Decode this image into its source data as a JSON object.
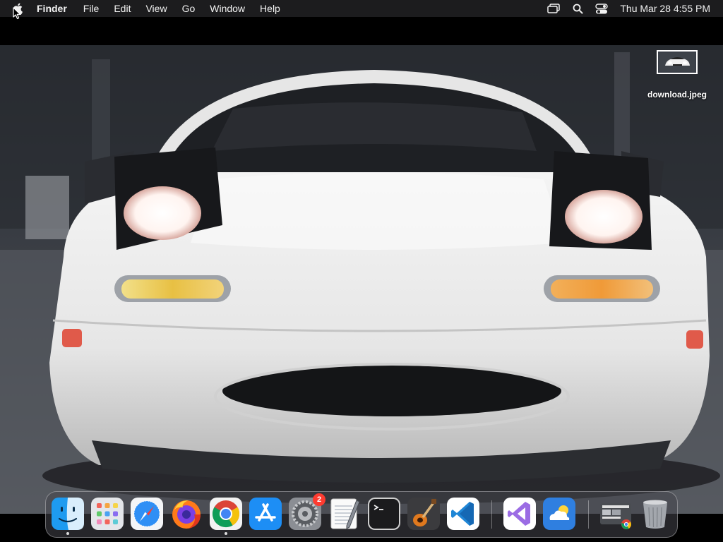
{
  "menubar": {
    "app_name": "Finder",
    "items": [
      "File",
      "Edit",
      "View",
      "Go",
      "Window",
      "Help"
    ],
    "status_icons": [
      "screen-mirroring-icon",
      "search-icon",
      "control-center-icon"
    ],
    "clock": "Thu Mar 28  4:55 PM"
  },
  "desktop": {
    "wallpaper": "white-roadster-front-photo",
    "icons": [
      {
        "label": "download.jpeg",
        "icon": "image-file-icon"
      }
    ]
  },
  "dock": {
    "apps": [
      {
        "name": "Finder",
        "icon": "finder-icon",
        "running": true
      },
      {
        "name": "Launchpad",
        "icon": "launchpad-icon",
        "running": false
      },
      {
        "name": "Safari",
        "icon": "safari-icon",
        "running": false
      },
      {
        "name": "Firefox",
        "icon": "firefox-icon",
        "running": false
      },
      {
        "name": "Google Chrome",
        "icon": "chrome-icon",
        "running": true
      },
      {
        "name": "App Store",
        "icon": "app-store-icon",
        "running": false
      },
      {
        "name": "System Settings",
        "icon": "system-settings-icon",
        "running": false,
        "badge": "2"
      },
      {
        "name": "TextEdit",
        "icon": "textedit-icon",
        "running": false
      },
      {
        "name": "Terminal",
        "icon": "terminal-icon",
        "running": false
      },
      {
        "name": "GarageBand",
        "icon": "garageband-icon",
        "running": false
      },
      {
        "name": "Visual Studio Code",
        "icon": "vscode-icon",
        "running": false
      },
      {
        "name": "Visual Studio",
        "icon": "visual-studio-icon",
        "running": false
      },
      {
        "name": "Weather",
        "icon": "weather-icon",
        "running": false
      },
      {
        "name": "Chrome Apps",
        "icon": "chrome-apps-folder-icon",
        "running": false
      },
      {
        "name": "Trash",
        "icon": "trash-icon",
        "running": false
      }
    ]
  },
  "colors": {
    "menubar_bg": "#1c1c1e",
    "badge": "#ff3b30"
  }
}
